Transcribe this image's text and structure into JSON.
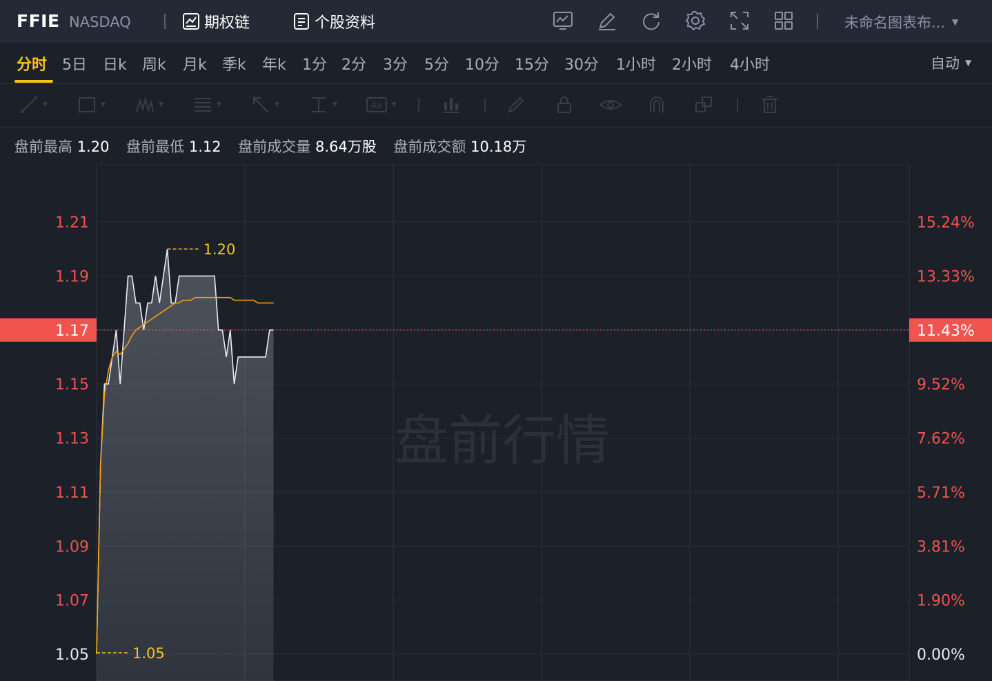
{
  "header": {
    "ticker": "FFIE",
    "exchange": "NASDAQ",
    "options_chain_label": "期权链",
    "profile_label": "个股资料",
    "layout_name": "未命名图表布..."
  },
  "tabs": [
    {
      "label": "分时",
      "active": true
    },
    {
      "label": "5日"
    },
    {
      "label": "日k"
    },
    {
      "label": "周k"
    },
    {
      "label": "月k"
    },
    {
      "label": "季k"
    },
    {
      "label": "年k"
    },
    {
      "label": "1分"
    },
    {
      "label": "2分"
    },
    {
      "label": "3分"
    },
    {
      "label": "5分"
    },
    {
      "label": "10分"
    },
    {
      "label": "15分"
    },
    {
      "label": "30分"
    },
    {
      "label": "1小时"
    },
    {
      "label": "2小时"
    },
    {
      "label": "4小时"
    }
  ],
  "scale_mode": "自动",
  "info": {
    "high_label": "盘前最高",
    "high_value": "1.20",
    "low_label": "盘前最低",
    "low_value": "1.12",
    "volume_label": "盘前成交量",
    "volume_value": "8.64万股",
    "amount_label": "盘前成交额",
    "amount_value": "10.18万"
  },
  "colors": {
    "up": "#f0544f",
    "price_line": "#e8ecf2",
    "avg_line": "#f39c12",
    "marker": "#f5c518"
  },
  "chart_data": {
    "type": "line",
    "watermark": "盘前行情",
    "price_ticks": [
      "1.21",
      "1.19",
      "1.17",
      "1.15",
      "1.13",
      "1.11",
      "1.09",
      "1.07",
      "1.05"
    ],
    "percent_ticks": [
      "15.24%",
      "13.33%",
      "11.43%",
      "9.52%",
      "7.62%",
      "5.71%",
      "3.81%",
      "1.90%",
      "0.00%"
    ],
    "ylim": [
      1.05,
      1.21
    ],
    "current_price": "1.17",
    "current_percent": "11.43%",
    "high_marker": "1.20",
    "low_marker": "1.05",
    "minutes": [
      0,
      1,
      2,
      3,
      4,
      5,
      6,
      7,
      8,
      9,
      10,
      11,
      12,
      13,
      14,
      15,
      16,
      17,
      18,
      19,
      20,
      21,
      22,
      23,
      24,
      25,
      26,
      27,
      28,
      29,
      30,
      31,
      32,
      33,
      34,
      35,
      36,
      37,
      38,
      39,
      40,
      41,
      42,
      43,
      44,
      45
    ],
    "series": [
      {
        "values": [
          1.05,
          1.12,
          1.15,
          1.15,
          1.16,
          1.17,
          1.15,
          1.17,
          1.19,
          1.19,
          1.18,
          1.18,
          1.17,
          1.18,
          1.18,
          1.19,
          1.18,
          1.19,
          1.2,
          1.18,
          1.18,
          1.19,
          1.19,
          1.19,
          1.19,
          1.19,
          1.19,
          1.19,
          1.19,
          1.19,
          1.19,
          1.17,
          1.17,
          1.16,
          1.17,
          1.15,
          1.16,
          1.16,
          1.16,
          1.16,
          1.16,
          1.16,
          1.16,
          1.16,
          1.17,
          1.17
        ]
      },
      {
        "values": [
          1.05,
          1.12,
          1.146,
          1.155,
          1.16,
          1.162,
          1.161,
          1.163,
          1.165,
          1.168,
          1.17,
          1.171,
          1.172,
          1.173,
          1.174,
          1.175,
          1.176,
          1.177,
          1.178,
          1.179,
          1.18,
          1.18,
          1.181,
          1.181,
          1.181,
          1.182,
          1.182,
          1.182,
          1.182,
          1.182,
          1.182,
          1.182,
          1.182,
          1.182,
          1.182,
          1.181,
          1.181,
          1.181,
          1.181,
          1.181,
          1.181,
          1.18,
          1.18,
          1.18,
          1.18,
          1.18
        ]
      }
    ]
  }
}
